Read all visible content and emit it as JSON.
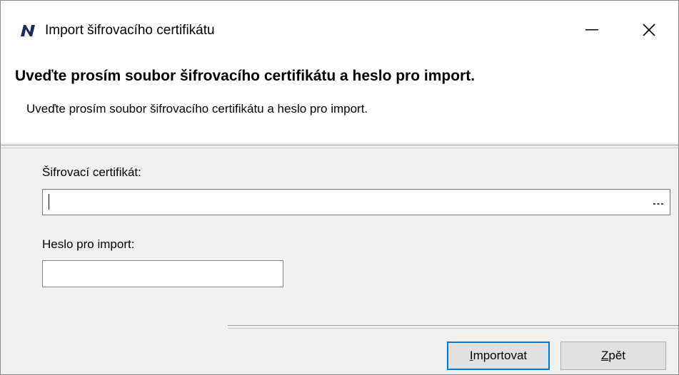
{
  "window": {
    "title": "Import šifrovacího certifikátu",
    "icon": "app-logo-icon",
    "minimize_icon": "minimize-icon",
    "close_icon": "close-icon"
  },
  "header": {
    "heading": "Uveďte prosím soubor šifrovacího certifikátu a heslo pro import.",
    "subheading": "Uveďte prosím soubor šifrovacího certifikátu a heslo pro import."
  },
  "form": {
    "certificate_label": "Šifrovací certifikát:",
    "certificate_value": "",
    "browse_icon": "ellipsis-icon",
    "password_label": "Heslo pro import:",
    "password_value": ""
  },
  "buttons": {
    "import_mnemonic": "I",
    "import_rest": "mportovat",
    "back_mnemonic": "Z",
    "back_rest": "pět"
  },
  "colors": {
    "accent": "#0078d7",
    "logo": "#1a2b5e"
  }
}
